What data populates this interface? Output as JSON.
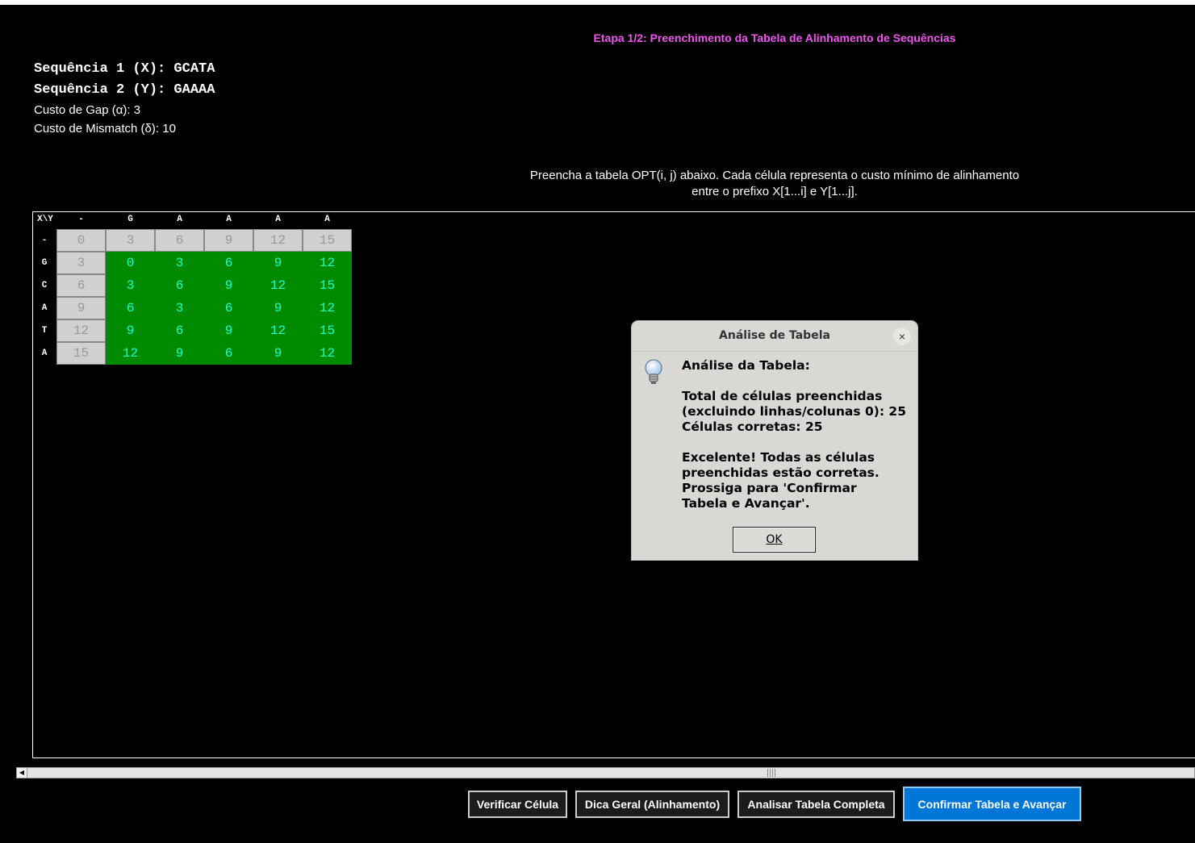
{
  "stage_title": "Etapa 1/2: Preenchimento da Tabela de Alinhamento de Sequências",
  "sequences": {
    "seq1": "Sequência 1 (X): GCATA",
    "seq2": "Sequência 2 (Y): GAAAA"
  },
  "costs": {
    "gap": "Custo de Gap (α): 3",
    "mismatch": "Custo de Mismatch (δ): 10"
  },
  "instructions": {
    "line1": "Preencha a tabela OPT(i, j) abaixo. Cada célula representa o custo mínimo de alinhamento",
    "line2": "entre o prefixo X[1...i] e Y[1...j]."
  },
  "table": {
    "corner": "X\\Y",
    "col_headers": [
      "-",
      "G",
      "A",
      "A",
      "A",
      "A"
    ],
    "row_headers": [
      "-",
      "G",
      "C",
      "A",
      "T",
      "A"
    ],
    "rows": [
      [
        "0",
        "3",
        "6",
        "9",
        "12",
        "15"
      ],
      [
        "3",
        "0",
        "3",
        "6",
        "9",
        "12"
      ],
      [
        "6",
        "3",
        "6",
        "9",
        "12",
        "15"
      ],
      [
        "9",
        "6",
        "3",
        "6",
        "9",
        "12"
      ],
      [
        "12",
        "9",
        "6",
        "9",
        "12",
        "15"
      ],
      [
        "15",
        "12",
        "9",
        "6",
        "9",
        "12"
      ]
    ]
  },
  "buttons": {
    "verify": "Verificar Célula",
    "hint": "Dica Geral (Alinhamento)",
    "analyze": "Analisar Tabela Completa",
    "confirm": "Confirmar Tabela e Avançar"
  },
  "dialog": {
    "title": "Análise de Tabela",
    "close": "×",
    "icon": "lightbulb-icon",
    "message": "Análise da Tabela:\n\nTotal de células preenchidas\n(excluindo linhas/colunas 0): 25\nCélulas corretas: 25\n\nExcelente! Todas as células\npreenchidas estão corretas.\nProssiga para 'Confirmar\nTabela e Avançar'.",
    "ok": "OK"
  },
  "colors": {
    "title": "#ee55ee",
    "filled_bg": "#008a00",
    "filled_text": "#19ffd0",
    "base_bg": "#d0d0d0",
    "primary_button": "#0077d8"
  }
}
